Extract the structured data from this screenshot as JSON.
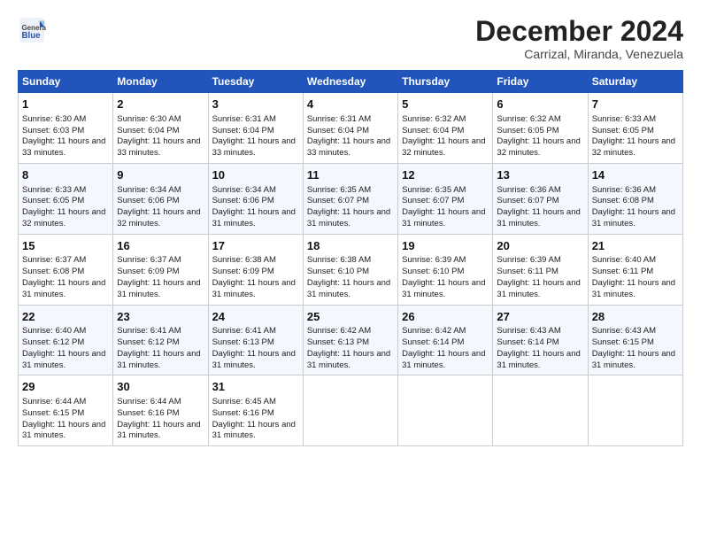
{
  "logo": {
    "general": "General",
    "blue": "Blue"
  },
  "title": "December 2024",
  "subtitle": "Carrizal, Miranda, Venezuela",
  "headers": [
    "Sunday",
    "Monday",
    "Tuesday",
    "Wednesday",
    "Thursday",
    "Friday",
    "Saturday"
  ],
  "weeks": [
    [
      {
        "day": "1",
        "sunrise": "Sunrise: 6:30 AM",
        "sunset": "Sunset: 6:03 PM",
        "daylight": "Daylight: 11 hours and 33 minutes."
      },
      {
        "day": "2",
        "sunrise": "Sunrise: 6:30 AM",
        "sunset": "Sunset: 6:04 PM",
        "daylight": "Daylight: 11 hours and 33 minutes."
      },
      {
        "day": "3",
        "sunrise": "Sunrise: 6:31 AM",
        "sunset": "Sunset: 6:04 PM",
        "daylight": "Daylight: 11 hours and 33 minutes."
      },
      {
        "day": "4",
        "sunrise": "Sunrise: 6:31 AM",
        "sunset": "Sunset: 6:04 PM",
        "daylight": "Daylight: 11 hours and 33 minutes."
      },
      {
        "day": "5",
        "sunrise": "Sunrise: 6:32 AM",
        "sunset": "Sunset: 6:04 PM",
        "daylight": "Daylight: 11 hours and 32 minutes."
      },
      {
        "day": "6",
        "sunrise": "Sunrise: 6:32 AM",
        "sunset": "Sunset: 6:05 PM",
        "daylight": "Daylight: 11 hours and 32 minutes."
      },
      {
        "day": "7",
        "sunrise": "Sunrise: 6:33 AM",
        "sunset": "Sunset: 6:05 PM",
        "daylight": "Daylight: 11 hours and 32 minutes."
      }
    ],
    [
      {
        "day": "8",
        "sunrise": "Sunrise: 6:33 AM",
        "sunset": "Sunset: 6:05 PM",
        "daylight": "Daylight: 11 hours and 32 minutes."
      },
      {
        "day": "9",
        "sunrise": "Sunrise: 6:34 AM",
        "sunset": "Sunset: 6:06 PM",
        "daylight": "Daylight: 11 hours and 32 minutes."
      },
      {
        "day": "10",
        "sunrise": "Sunrise: 6:34 AM",
        "sunset": "Sunset: 6:06 PM",
        "daylight": "Daylight: 11 hours and 31 minutes."
      },
      {
        "day": "11",
        "sunrise": "Sunrise: 6:35 AM",
        "sunset": "Sunset: 6:07 PM",
        "daylight": "Daylight: 11 hours and 31 minutes."
      },
      {
        "day": "12",
        "sunrise": "Sunrise: 6:35 AM",
        "sunset": "Sunset: 6:07 PM",
        "daylight": "Daylight: 11 hours and 31 minutes."
      },
      {
        "day": "13",
        "sunrise": "Sunrise: 6:36 AM",
        "sunset": "Sunset: 6:07 PM",
        "daylight": "Daylight: 11 hours and 31 minutes."
      },
      {
        "day": "14",
        "sunrise": "Sunrise: 6:36 AM",
        "sunset": "Sunset: 6:08 PM",
        "daylight": "Daylight: 11 hours and 31 minutes."
      }
    ],
    [
      {
        "day": "15",
        "sunrise": "Sunrise: 6:37 AM",
        "sunset": "Sunset: 6:08 PM",
        "daylight": "Daylight: 11 hours and 31 minutes."
      },
      {
        "day": "16",
        "sunrise": "Sunrise: 6:37 AM",
        "sunset": "Sunset: 6:09 PM",
        "daylight": "Daylight: 11 hours and 31 minutes."
      },
      {
        "day": "17",
        "sunrise": "Sunrise: 6:38 AM",
        "sunset": "Sunset: 6:09 PM",
        "daylight": "Daylight: 11 hours and 31 minutes."
      },
      {
        "day": "18",
        "sunrise": "Sunrise: 6:38 AM",
        "sunset": "Sunset: 6:10 PM",
        "daylight": "Daylight: 11 hours and 31 minutes."
      },
      {
        "day": "19",
        "sunrise": "Sunrise: 6:39 AM",
        "sunset": "Sunset: 6:10 PM",
        "daylight": "Daylight: 11 hours and 31 minutes."
      },
      {
        "day": "20",
        "sunrise": "Sunrise: 6:39 AM",
        "sunset": "Sunset: 6:11 PM",
        "daylight": "Daylight: 11 hours and 31 minutes."
      },
      {
        "day": "21",
        "sunrise": "Sunrise: 6:40 AM",
        "sunset": "Sunset: 6:11 PM",
        "daylight": "Daylight: 11 hours and 31 minutes."
      }
    ],
    [
      {
        "day": "22",
        "sunrise": "Sunrise: 6:40 AM",
        "sunset": "Sunset: 6:12 PM",
        "daylight": "Daylight: 11 hours and 31 minutes."
      },
      {
        "day": "23",
        "sunrise": "Sunrise: 6:41 AM",
        "sunset": "Sunset: 6:12 PM",
        "daylight": "Daylight: 11 hours and 31 minutes."
      },
      {
        "day": "24",
        "sunrise": "Sunrise: 6:41 AM",
        "sunset": "Sunset: 6:13 PM",
        "daylight": "Daylight: 11 hours and 31 minutes."
      },
      {
        "day": "25",
        "sunrise": "Sunrise: 6:42 AM",
        "sunset": "Sunset: 6:13 PM",
        "daylight": "Daylight: 11 hours and 31 minutes."
      },
      {
        "day": "26",
        "sunrise": "Sunrise: 6:42 AM",
        "sunset": "Sunset: 6:14 PM",
        "daylight": "Daylight: 11 hours and 31 minutes."
      },
      {
        "day": "27",
        "sunrise": "Sunrise: 6:43 AM",
        "sunset": "Sunset: 6:14 PM",
        "daylight": "Daylight: 11 hours and 31 minutes."
      },
      {
        "day": "28",
        "sunrise": "Sunrise: 6:43 AM",
        "sunset": "Sunset: 6:15 PM",
        "daylight": "Daylight: 11 hours and 31 minutes."
      }
    ],
    [
      {
        "day": "29",
        "sunrise": "Sunrise: 6:44 AM",
        "sunset": "Sunset: 6:15 PM",
        "daylight": "Daylight: 11 hours and 31 minutes."
      },
      {
        "day": "30",
        "sunrise": "Sunrise: 6:44 AM",
        "sunset": "Sunset: 6:16 PM",
        "daylight": "Daylight: 11 hours and 31 minutes."
      },
      {
        "day": "31",
        "sunrise": "Sunrise: 6:45 AM",
        "sunset": "Sunset: 6:16 PM",
        "daylight": "Daylight: 11 hours and 31 minutes."
      },
      null,
      null,
      null,
      null
    ]
  ]
}
